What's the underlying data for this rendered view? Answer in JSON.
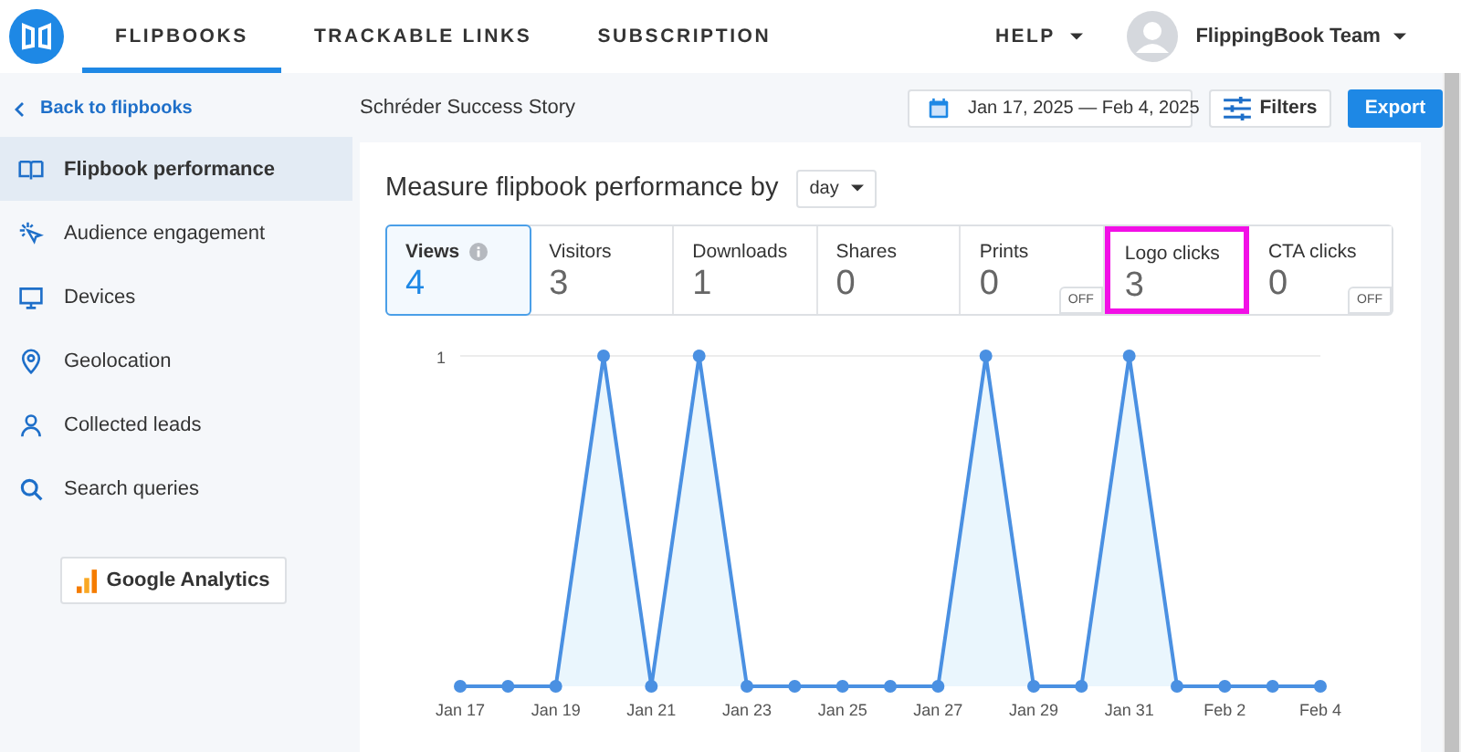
{
  "nav": {
    "tabs": [
      {
        "label": "FLIPBOOKS",
        "selected": true
      },
      {
        "label": "TRACKABLE LINKS",
        "selected": false
      },
      {
        "label": "SUBSCRIPTION",
        "selected": false
      }
    ],
    "help": "HELP",
    "user": "FlippingBook Team"
  },
  "back": "Back to flipbooks",
  "title": "Schréder Success Story",
  "date_range": "Jan 17, 2025 — Feb 4, 2025",
  "filters": "Filters",
  "export": "Export",
  "sidebar": {
    "items": [
      {
        "label": "Flipbook performance",
        "selected": true
      },
      {
        "label": "Audience engagement",
        "selected": false
      },
      {
        "label": "Devices",
        "selected": false
      },
      {
        "label": "Geolocation",
        "selected": false
      },
      {
        "label": "Collected leads",
        "selected": false
      },
      {
        "label": "Search queries",
        "selected": false
      }
    ],
    "analytics_button": "Google Analytics"
  },
  "panel": {
    "heading": "Measure flipbook performance by",
    "period": "day",
    "metrics": [
      {
        "label": "Views",
        "value": "4",
        "selected": true,
        "info": true,
        "highlighted": false
      },
      {
        "label": "Visitors",
        "value": "3",
        "selected": false,
        "highlighted": false
      },
      {
        "label": "Downloads",
        "value": "1",
        "selected": false,
        "highlighted": false
      },
      {
        "label": "Shares",
        "value": "0",
        "selected": false,
        "highlighted": false
      },
      {
        "label": "Prints",
        "value": "0",
        "selected": false,
        "badge": "OFF",
        "highlighted": false
      },
      {
        "label": "Logo clicks",
        "value": "3",
        "selected": false,
        "highlighted": true
      },
      {
        "label": "CTA clicks",
        "value": "0",
        "selected": false,
        "badge": "OFF",
        "highlighted": false
      }
    ],
    "chart_data": {
      "type": "area",
      "categories": [
        "Jan 17",
        null,
        "Jan 19",
        null,
        "Jan 21",
        null,
        "Jan 23",
        null,
        "Jan 25",
        null,
        "Jan 27",
        null,
        "Jan 29",
        null,
        "Jan 31",
        null,
        "Feb 2",
        null,
        "Feb 4"
      ],
      "series": [
        {
          "color": "#4a90e2",
          "values": [
            0,
            0,
            0,
            1,
            0,
            1,
            0,
            0,
            0,
            0,
            0,
            1,
            0,
            0,
            1,
            0,
            0,
            0,
            0
          ]
        }
      ],
      "ylim": [
        0,
        1
      ],
      "yticks": [
        {
          "value": 1,
          "label": "1"
        }
      ]
    }
  }
}
